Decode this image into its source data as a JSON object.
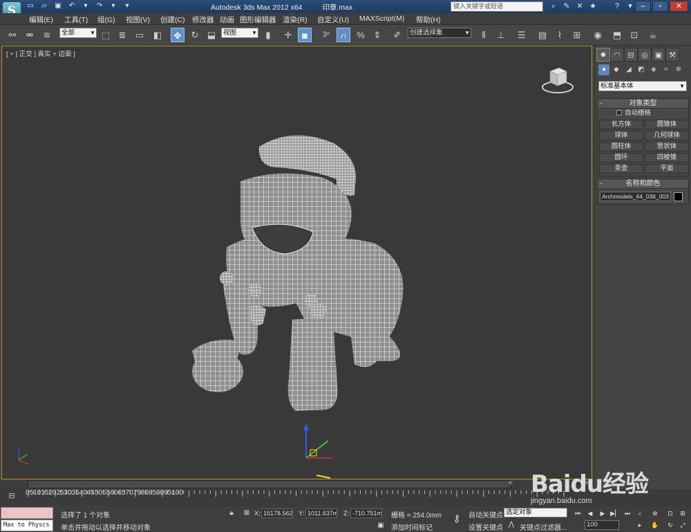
{
  "title": {
    "app": "Autodesk 3ds Max  2012 x64",
    "file": "印章.max",
    "search_placeholder": "键入关键字或短语"
  },
  "menu": [
    "编辑(E)",
    "工具(T)",
    "组(G)",
    "视图(V)",
    "创建(C)",
    "修改器",
    "动画",
    "图形编辑器",
    "渲染(R)",
    "自定义(U)",
    "MAXScript(M)",
    "帮助(H)"
  ],
  "toolbar": {
    "selection_filter": "全部",
    "reference_coord": "视图",
    "named_selection": "创建选择集",
    "snap_label": "3",
    "percent_label": "%"
  },
  "viewport": {
    "label": "[ + ] 正交 ] 真实 + 边面 ]"
  },
  "command_panel": {
    "category": "标准基本体",
    "object_type_title": "对象类型",
    "autogrid_label": "自动栅格",
    "object_buttons": [
      "长方体",
      "圆锥体",
      "球体",
      "几何球体",
      "圆柱体",
      "管状体",
      "圆环",
      "四棱锥",
      "茶壶",
      "平面"
    ],
    "name_color_title": "名称和颜色",
    "object_name": "Archmodels_64_036_003",
    "object_color": "#000000"
  },
  "timeline": {
    "ticks": [
      "0",
      "5",
      "10",
      "15",
      "20",
      "25",
      "30",
      "35",
      "40",
      "45",
      "50",
      "55",
      "60",
      "65",
      "70",
      "75",
      "80",
      "85",
      "90",
      "95",
      "100"
    ]
  },
  "status": {
    "maxscript_text": "Max to Physcs (",
    "selection_status": "选择了 1 个对象",
    "prompt": "单击并拖动以选择并移动对象",
    "x_label": "X:",
    "x_value": "15178.562",
    "y_label": "Y:",
    "y_value": "1011.637m",
    "z_label": "Z:",
    "z_value": "-710.751m",
    "grid": "栅格 = 254.0mm",
    "add_time_tag": "添加时间标记",
    "auto_key": "自动关键点",
    "selected_object": "选定对象",
    "set_key": "设置关键点",
    "key_filters": "关键点过滤器...",
    "frame_value": "100"
  },
  "watermark": {
    "brand": "Baidu经验",
    "url": "jingyan.baidu.com"
  }
}
